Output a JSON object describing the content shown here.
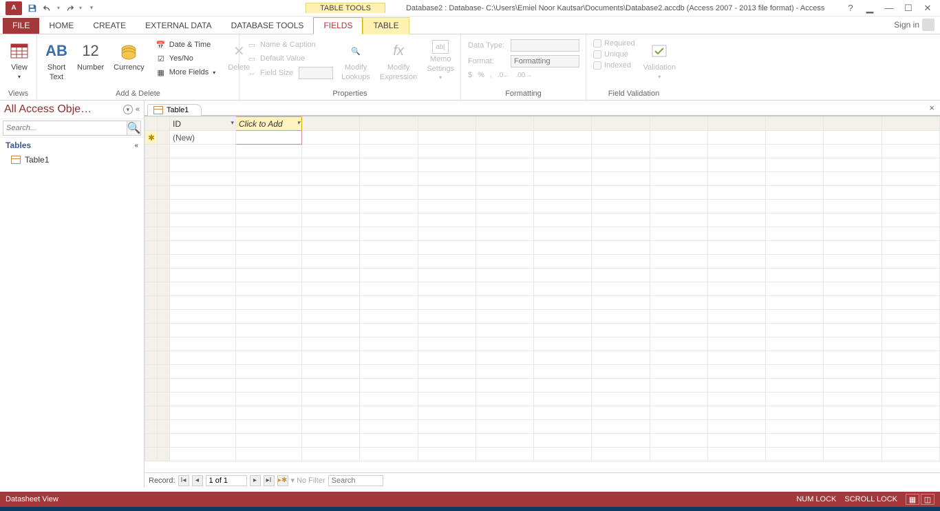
{
  "titlebar": {
    "tooltitle": "TABLE TOOLS",
    "wintitle": "Database2 : Database- C:\\Users\\Emiel Noor Kautsar\\Documents\\Database2.accdb (Access 2007 - 2013 file format) - Access"
  },
  "menu": {
    "file": "FILE",
    "home": "HOME",
    "create": "CREATE",
    "external": "EXTERNAL DATA",
    "dbtools": "DATABASE TOOLS",
    "fields": "FIELDS",
    "table": "TABLE",
    "signin": "Sign in"
  },
  "ribbon": {
    "views": {
      "view": "View",
      "label": "Views"
    },
    "addDelete": {
      "short1": "Short",
      "short2": "Text",
      "number": "Number",
      "currency": "Currency",
      "dateTime": "Date & Time",
      "yesNo": "Yes/No",
      "more": "More Fields",
      "delete": "Delete",
      "label": "Add & Delete"
    },
    "properties": {
      "nameCaption": "Name & Caption",
      "defaultValue": "Default Value",
      "fieldSize": "Field Size",
      "modifyLookups1": "Modify",
      "modifyLookups2": "Lookups",
      "modifyExpr1": "Modify",
      "modifyExpr2": "Expression",
      "memo1": "Memo",
      "memo2": "Settings",
      "label": "Properties"
    },
    "formatting": {
      "dataType": "Data Type:",
      "format": "Format:",
      "formatPh": "Formatting",
      "label": "Formatting"
    },
    "validation": {
      "required": "Required",
      "unique": "Unique",
      "indexed": "Indexed",
      "validation": "Validation",
      "label": "Field Validation"
    }
  },
  "nav": {
    "header": "All Access Obje…",
    "searchPh": "Search...",
    "tables": "Tables",
    "table1": "Table1"
  },
  "doc": {
    "tab": "Table1",
    "idcol": "ID",
    "addcol": "Click to Add",
    "newrow": "(New)"
  },
  "recordnav": {
    "label": "Record:",
    "pos": "1 of 1",
    "nofilter": "No Filter",
    "searchPh": "Search"
  },
  "status": {
    "view": "Datasheet View",
    "numlock": "NUM LOCK",
    "scrolllock": "SCROLL LOCK"
  }
}
